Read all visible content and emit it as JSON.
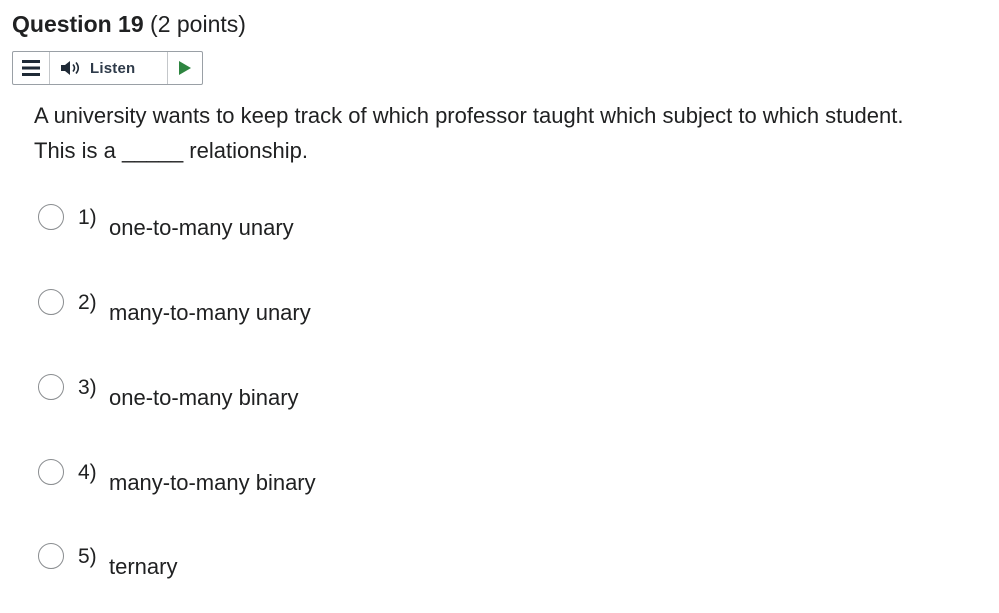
{
  "question": {
    "title": "Question 19",
    "points": "(2 points)",
    "text": "A university wants to keep track of which professor taught which subject to which student. This is a _____ relationship."
  },
  "listen_bar": {
    "menu_icon": "hamburger-menu-icon",
    "speaker_icon": "speaker-icon",
    "listen_label": "Listen",
    "play_icon": "play-icon",
    "play_color": "#2e8540"
  },
  "options": [
    {
      "number": "1)",
      "text": "one-to-many unary",
      "selected": false
    },
    {
      "number": "2)",
      "text": "many-to-many unary",
      "selected": false
    },
    {
      "number": "3)",
      "text": "one-to-many binary",
      "selected": false
    },
    {
      "number": "4)",
      "text": "many-to-many binary",
      "selected": false
    },
    {
      "number": "5)",
      "text": "ternary",
      "selected": false
    }
  ]
}
